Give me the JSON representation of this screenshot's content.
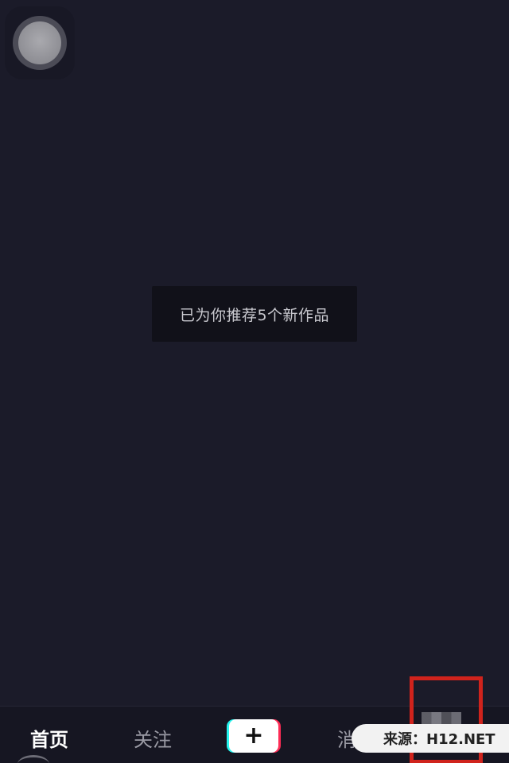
{
  "toast": {
    "message": "已为你推荐5个新作品"
  },
  "tabbar": {
    "home_label": "首页",
    "follow_label": "关注",
    "create_label": "+",
    "message_label": "消"
  },
  "watermark": {
    "text": "来源：H12.NET"
  },
  "colors": {
    "background": "#1b1b29",
    "highlight_box": "#d0231c",
    "create_button_cyan": "#25f4ee",
    "create_button_red": "#fe2c55"
  }
}
